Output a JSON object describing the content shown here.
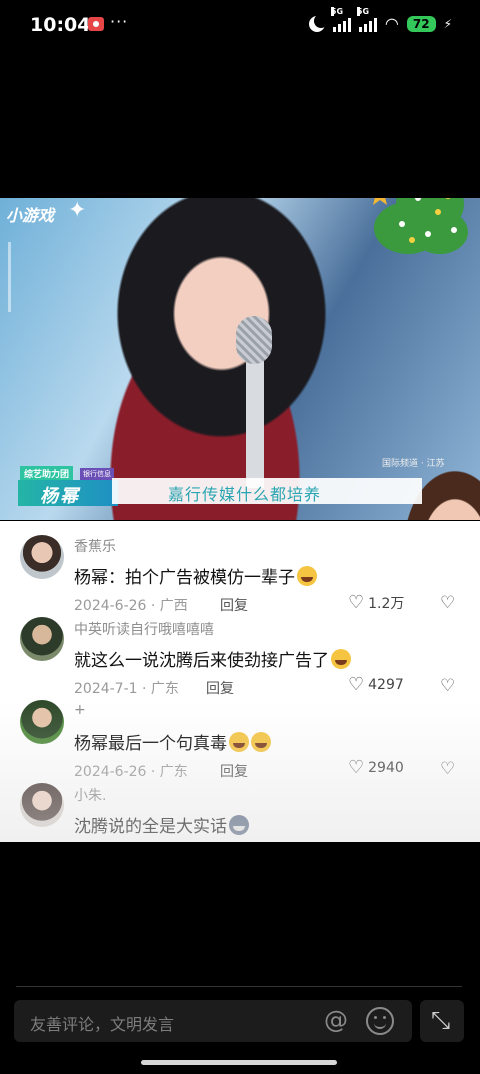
{
  "status_bar": {
    "time": "10:04",
    "more": "···",
    "network1": "5G",
    "network2": "5G",
    "battery": "72"
  },
  "video": {
    "corner_label": "小游戏",
    "chip_left": "综艺助力团",
    "chip_right": "银行信息",
    "name_label": "杨幂",
    "caption": "嘉行传媒什么都培养",
    "watermark": "国际频道 · 江苏"
  },
  "comments": [
    {
      "user": "香蕉乐",
      "text": "杨幂：拍个广告被模仿一辈子",
      "emoji": "crying-emoji",
      "date_loc": "2024-6-26 · 广西",
      "reply": "回复",
      "likes": "1.2万"
    },
    {
      "user": "中英听读自行哦嘻嘻嘻",
      "text": "就这么一说沈腾后来使劲接广告了",
      "emoji": "laughing-emoji",
      "date_loc": "2024-7-1 · 广东",
      "reply": "回复",
      "likes": "4297"
    },
    {
      "user": "+",
      "text": "杨幂最后一个句真毒",
      "emoji": "laughing-emoji",
      "date_loc": "2024-6-26 · 广东",
      "reply": "回复",
      "likes": "2940"
    },
    {
      "user": "小朱.",
      "text": "沈腾说的全是大实话",
      "emoji": "cat-emoji",
      "date_loc": "",
      "reply": "",
      "likes": ""
    }
  ],
  "bottom": {
    "input_placeholder": "友善评论，文明发言",
    "at_symbol": "@",
    "collapse_glyph": "⤡"
  },
  "colors": {
    "battery": "#34c759",
    "caption_text": "#2aa6b2",
    "record": "#e64646"
  }
}
